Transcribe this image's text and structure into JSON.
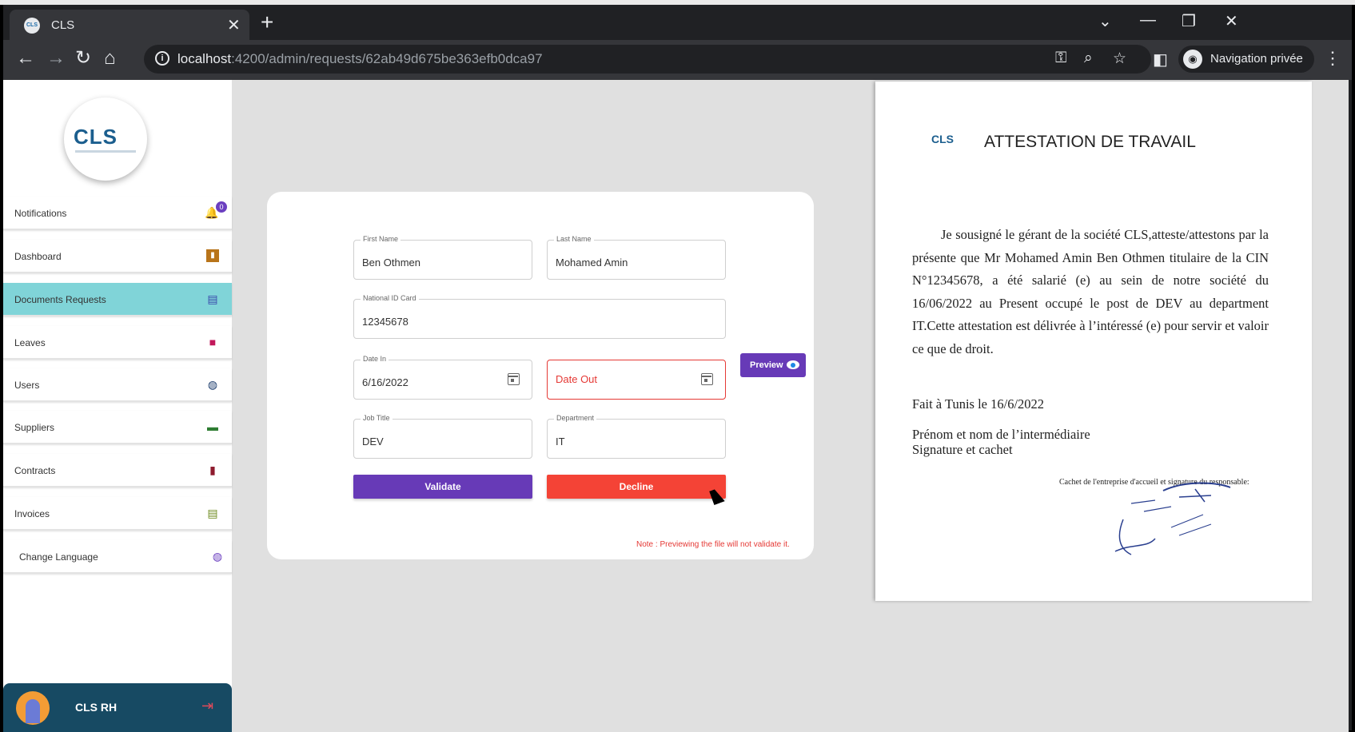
{
  "browser": {
    "tab_title": "CLS",
    "favicon_text": "CLS",
    "url_host": "localhost",
    "url_rest": ":4200/admin/requests/62ab49d675be363efb0dca97",
    "profile_label": "Navigation privée"
  },
  "sidebar": {
    "logo_text": "CLS",
    "notifications_count": "0",
    "items": [
      {
        "label": "Notifications",
        "icon": "bell-icon"
      },
      {
        "label": "Dashboard",
        "icon": "chart-icon"
      },
      {
        "label": "Documents Requests",
        "icon": "document-icon"
      },
      {
        "label": "Leaves",
        "icon": "leave-icon"
      },
      {
        "label": "Users",
        "icon": "users-icon"
      },
      {
        "label": "Suppliers",
        "icon": "truck-icon"
      },
      {
        "label": "Contracts",
        "icon": "bookmark-icon"
      },
      {
        "label": "Invoices",
        "icon": "invoice-icon"
      },
      {
        "label": "Change Language",
        "icon": "globe-icon"
      }
    ],
    "user_name": "CLS RH"
  },
  "form": {
    "first_name_label": "First Name",
    "first_name_value": "Ben Othmen",
    "last_name_label": "Last Name",
    "last_name_value": "Mohamed Amin",
    "cin_label": "National ID Card",
    "cin_value": "12345678",
    "date_in_label": "Date In",
    "date_in_value": "6/16/2022",
    "date_out_placeholder": "Date Out",
    "job_title_label": "Job Title",
    "job_title_value": "DEV",
    "department_label": "Department",
    "department_value": "IT",
    "validate_label": "Validate",
    "decline_label": "Decline",
    "preview_label": "Preview",
    "note": "Note : Previewing the file will not validate it."
  },
  "document": {
    "logo_text": "CLS",
    "title": "ATTESTATION DE TRAVAIL",
    "body": "Je sousigné le gérant de la société CLS,atteste/attestons par la présente que Mr Mohamed Amin Ben Othmen titulaire de la CIN N°12345678, a été salarié (e) au sein de notre société du 16/06/2022 au Present occupé le post de DEV au department IT.Cette attestation est délivrée à l’intéressé (e) pour servir et valoir ce que de droit.",
    "place_date": "Fait à Tunis le 16/6/2022",
    "signature_line1": "Prénom et nom de l’intermédiaire",
    "signature_line2": "Signature et cachet",
    "cachet_note": "Cachet de l'entreprise d'accueil et signature du responsable:"
  },
  "colors": {
    "active_nav": "#80d4d8",
    "primary": "#673ab7",
    "danger": "#f44336",
    "user_bar": "#174a63"
  }
}
